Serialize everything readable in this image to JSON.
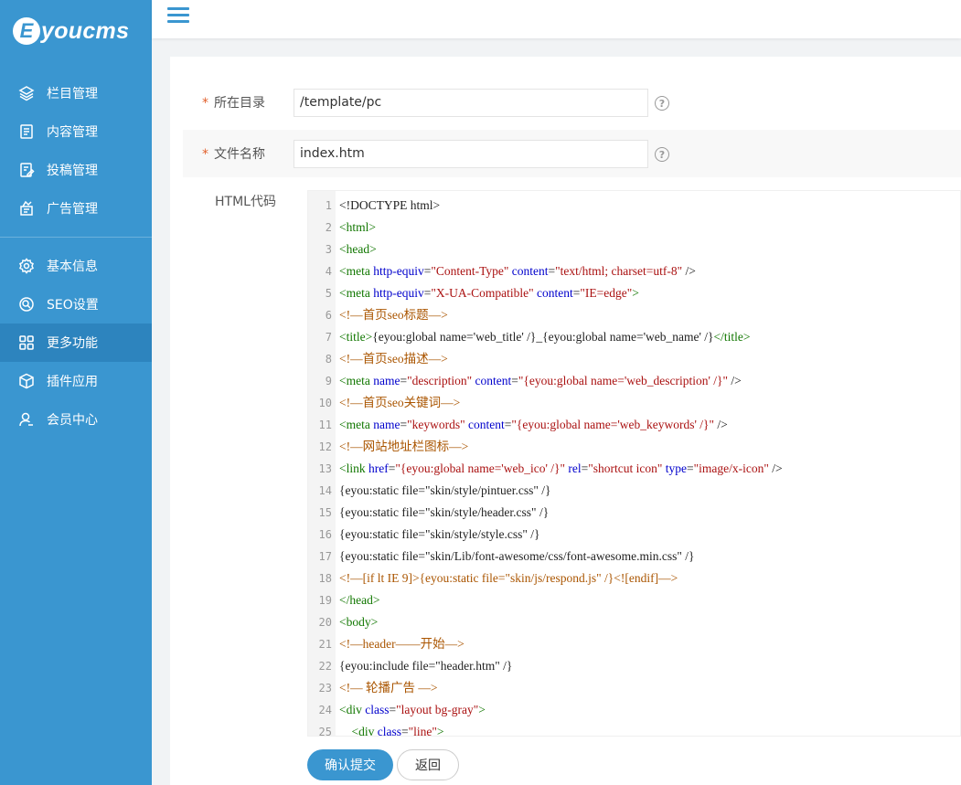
{
  "logo": {
    "letter": "E",
    "text": "youcms"
  },
  "sidebar": {
    "items": [
      {
        "label": "栏目管理",
        "icon": "layers-icon"
      },
      {
        "label": "内容管理",
        "icon": "document-icon"
      },
      {
        "label": "投稿管理",
        "icon": "edit-icon"
      },
      {
        "label": "广告管理",
        "icon": "ad-icon"
      }
    ],
    "items2": [
      {
        "label": "基本信息",
        "icon": "gear-icon"
      },
      {
        "label": "SEO设置",
        "icon": "seo-icon"
      },
      {
        "label": "更多功能",
        "icon": "grid-icon",
        "active": true
      },
      {
        "label": "插件应用",
        "icon": "cube-icon"
      },
      {
        "label": "会员中心",
        "icon": "user-icon"
      }
    ]
  },
  "form": {
    "dir_label": "所在目录",
    "dir_value": "/template/pc",
    "file_label": "文件名称",
    "file_value": "index.htm",
    "required_mark": "*",
    "help_glyph": "?",
    "code_label": "HTML代码",
    "submit_label": "确认提交",
    "back_label": "返回"
  },
  "code_lines": [
    "<!DOCTYPE html>",
    "<html>",
    "<head>",
    "<meta http-equiv=\"Content-Type\" content=\"text/html; charset=utf-8\" />",
    "<meta http-equiv=\"X-UA-Compatible\" content=\"IE=edge\">",
    "<!—首页seo标题—>",
    "<title>{eyou:global name='web_title' /}_{eyou:global name='web_name' /}</title>",
    "<!—首页seo描述—>",
    "<meta name=\"description\" content=\"{eyou:global name='web_description' /}\" />",
    "<!—首页seo关键词—>",
    "<meta name=\"keywords\" content=\"{eyou:global name='web_keywords' /}\" />",
    "<!—网站地址栏图标—>",
    "<link href=\"{eyou:global name='web_ico' /}\" rel=\"shortcut icon\" type=\"image/x-icon\" />",
    "{eyou:static file=\"skin/style/pintuer.css\" /}",
    "{eyou:static file=\"skin/style/header.css\" /}",
    "{eyou:static file=\"skin/style/style.css\" /}",
    "{eyou:static file=\"skin/Lib/font-awesome/css/font-awesome.min.css\" /}",
    "<!—[if lt IE 9]>{eyou:static file=\"skin/js/respond.js\" /}<![endif]—>",
    "</head>",
    "<body>",
    "<!—header——开始—>",
    "{eyou:include file=\"header.htm\" /}",
    "<!— 轮播广告 —>",
    "<div class=\"layout bg-gray\">",
    "    <div class=\"line\">"
  ],
  "colors": {
    "brand": "#3a96d0",
    "active": "#2d84be",
    "required": "#e15f2a"
  }
}
